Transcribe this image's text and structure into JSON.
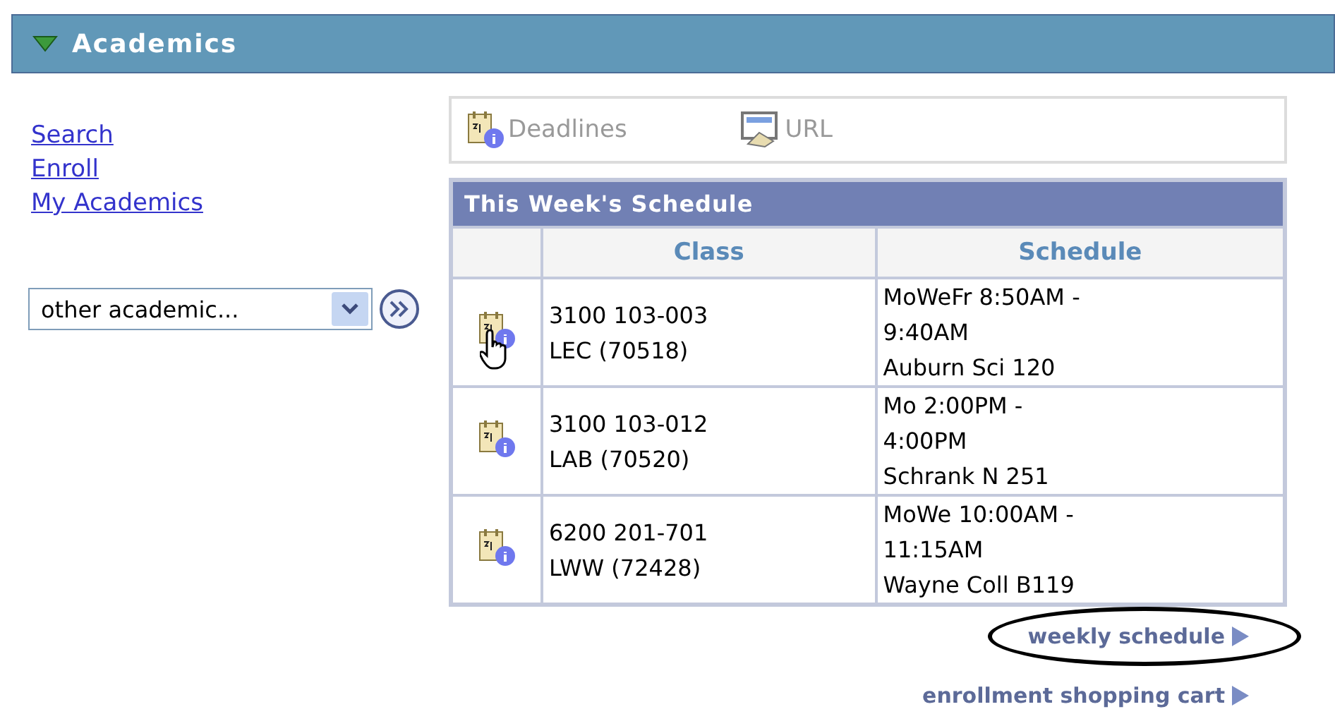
{
  "header": {
    "title": "Academics",
    "expanded": true
  },
  "links": [
    "Search",
    "Enroll",
    "My Academics"
  ],
  "dropdown": {
    "value": "other academic..."
  },
  "toolbar": [
    {
      "kind": "deadlines",
      "label": "Deadlines"
    },
    {
      "kind": "url",
      "label": "URL"
    }
  ],
  "schedule": {
    "title": "This Week's Schedule",
    "columns": [
      "Class",
      "Schedule"
    ],
    "rows": [
      {
        "hovered": true,
        "class": [
          "3100 103-003",
          "LEC (70518)"
        ],
        "schedule": [
          "MoWeFr 8:50AM -",
          "9:40AM",
          "Auburn Sci 120"
        ]
      },
      {
        "hovered": false,
        "class": [
          "3100 103-012",
          "LAB (70520)"
        ],
        "schedule": [
          "Mo 2:00PM -",
          "4:00PM",
          "Schrank N 251"
        ]
      },
      {
        "hovered": false,
        "class": [
          "6200 201-701",
          "LWW (72428)"
        ],
        "schedule": [
          "MoWe 10:00AM -",
          "11:15AM",
          "Wayne Coll B119"
        ]
      }
    ]
  },
  "footer_links": [
    {
      "label": "weekly schedule",
      "circled": true
    },
    {
      "label": "enrollment shopping cart",
      "circled": false
    }
  ]
}
